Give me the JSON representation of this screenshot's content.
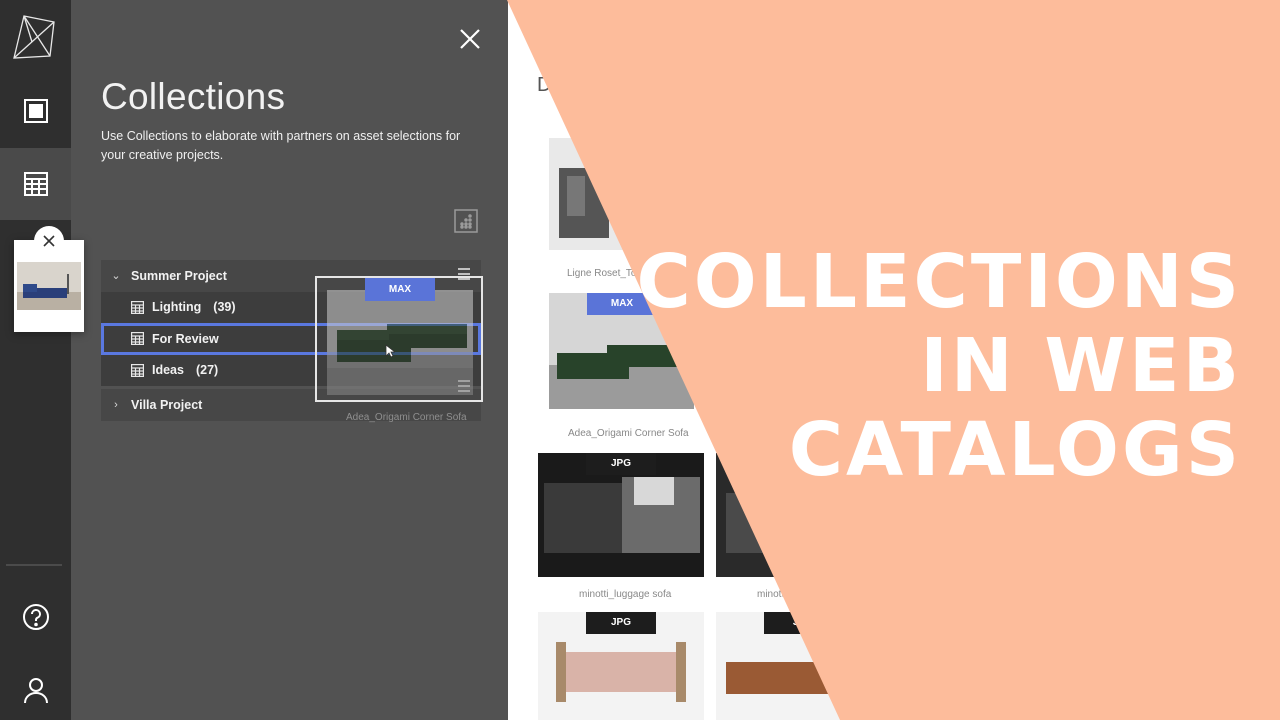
{
  "panel": {
    "title": "Collections",
    "description": "Use Collections to elaborate with partners on asset selections for your creative projects."
  },
  "tree": {
    "groups": [
      {
        "name": "Summer Project",
        "expanded": true,
        "children": [
          {
            "label": "Lighting",
            "count": "(39)"
          },
          {
            "label": "For Review",
            "count": "",
            "selected": true
          },
          {
            "label": "Ideas",
            "count": "(27)"
          }
        ]
      },
      {
        "name": "Villa Project",
        "expanded": false
      }
    ]
  },
  "drag_preview": {
    "badge": "MAX",
    "caption": "Adea_Origami Corner Sofa"
  },
  "catalog": {
    "heading_partial": "D",
    "tiles": [
      {
        "caption": "Ligne Roset_Tog",
        "badge": ""
      },
      {
        "caption": "Adea_Origami Corner Sofa",
        "badge": "MAX"
      },
      {
        "caption": "minotti_luggage sofa",
        "badge": "JPG"
      },
      {
        "caption": "minotti",
        "badge": ""
      },
      {
        "caption": "",
        "badge": "JPG"
      },
      {
        "caption": "",
        "badge": "JP"
      }
    ]
  },
  "overlay": {
    "line1": "COLLECTIONS",
    "line2": "IN WEB",
    "line3": "CATALOGS",
    "color": "#fdbc9b"
  },
  "colors": {
    "rail": "#2f2f2f",
    "panel": "#525252",
    "accent": "#5a78e0"
  },
  "icons": {
    "logo": "origami-logo-icon",
    "rail": [
      "dashboard-icon",
      "collections-grid-icon",
      "help-icon",
      "user-icon"
    ]
  }
}
